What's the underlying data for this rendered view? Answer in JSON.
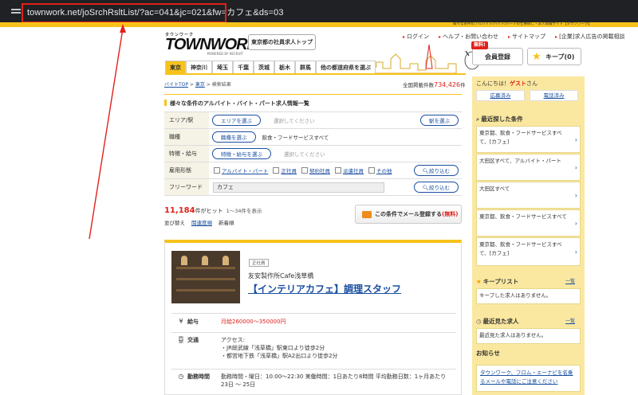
{
  "browser": {
    "url": "townwork.net/joSrchRsltList/?ac=041&jc=021&fw=カフェ&ds=03"
  },
  "topbar": {
    "tagline": "様々な条件のアルバイト/バイト/パートの仕事探し・求人情報サイト【タウンワーク】"
  },
  "header": {
    "logo_sub": "タウンワーク",
    "logo_main": "TOWNWORK",
    "logo_powered": "POWERED BY RECRUIT",
    "tokyo_button": "東京都の社員求人トップ",
    "links": [
      "ログイン",
      "ヘルプ・お問い合わせ",
      "サイトマップ",
      "[企業]求人広告の掲載相談"
    ],
    "register": "会員登録",
    "register_badge": "無料!",
    "keep": "キープ(0)"
  },
  "prefnav": [
    "東京",
    "神奈川",
    "埼玉",
    "千葉",
    "茨城",
    "栃木",
    "群馬",
    "他の都道府県を選ぶ"
  ],
  "breadcrumb": {
    "items": [
      "バイトTOP",
      "東京",
      "検索結果"
    ]
  },
  "total": {
    "label": "全国掲載件数",
    "count": "734,426",
    "unit": "件"
  },
  "page_title": "様々な条件のアルバイト・バイト・パート求人情報一覧",
  "search": {
    "area_label": "エリア/駅",
    "area_button": "エリアを選ぶ",
    "area_value": "選択してください",
    "station_button": "駅を選ぶ",
    "job_label": "職種",
    "job_button": "職種を選ぶ",
    "job_value": "飲食・フードサービスすべて",
    "feature_label": "特徴・給与",
    "feature_button": "特徴・給与を選ぶ",
    "feature_value": "選択してください",
    "employment_label": "雇用形態",
    "employment_options": [
      "アルバイト・パート",
      "正社員",
      "契約社員",
      "派遣社員",
      "その他"
    ],
    "narrow_button": "絞り込む",
    "freeword_label": "フリーワード",
    "freeword_value": "カフェ",
    "narrow_button2": "絞り込む"
  },
  "results": {
    "count": "11,184",
    "unit": "件がヒット",
    "range": "1〜34件を表示"
  },
  "sort": {
    "label": "並び替え",
    "options": [
      "関連度順",
      "新着順"
    ]
  },
  "mail_button": {
    "text": "この条件でメール登録する",
    "free": "(無料)"
  },
  "job": {
    "tag": "正社員",
    "company": "友安製作所Cafe浅草橋",
    "title": "【インテリアカフェ】調理スタッフ",
    "salary_label": "給与",
    "salary_value": "月給260000〜350000円",
    "access_label": "交通",
    "access_lines": [
      "アクセス:",
      "・JR総武線「浅草橋」駅東口より徒歩2分",
      "・都営地下鉄「浅草橋」駅A2出口より徒歩2分"
    ],
    "hours_label": "勤務時間",
    "hours_lines": [
      "勤務時間・曜日：10:00〜22:30 実働時間：1日あたり8時間 平均勤務日数：1ヶ月あたり",
      "23日 〜 25日"
    ]
  },
  "sidebar": {
    "greeting_pre": "こんにちは！",
    "guest": "ゲスト",
    "greeting_post": "さん",
    "btn_applied": "応募済み",
    "btn_phone": "電話済み",
    "recent_title": "最近探した条件",
    "recent_items": [
      "東京都、飲食・フードサービスすべて、[カフェ]",
      "大田区すべて、アルバイト・パート",
      "大田区すべて",
      "東京都、飲食・フードサービスすべて",
      "東京都、飲食・フードサービスすべて、[カフェ]"
    ],
    "keep_title": "キープリスト",
    "keep_more": "一覧",
    "keep_empty": "キープした求人はありません。",
    "viewed_title": "最近見た求人",
    "viewed_more": "一覧",
    "viewed_empty": "最近見た求人はありません。",
    "news_title": "お知らせ",
    "news_text": "タウンワーク、フロム・エーナビを名乗るメールや電話にご注意ください"
  },
  "colors": {
    "brand_yellow": "#f7c21a",
    "link_blue": "#1a4fa0",
    "accent_red": "#e0211b"
  }
}
